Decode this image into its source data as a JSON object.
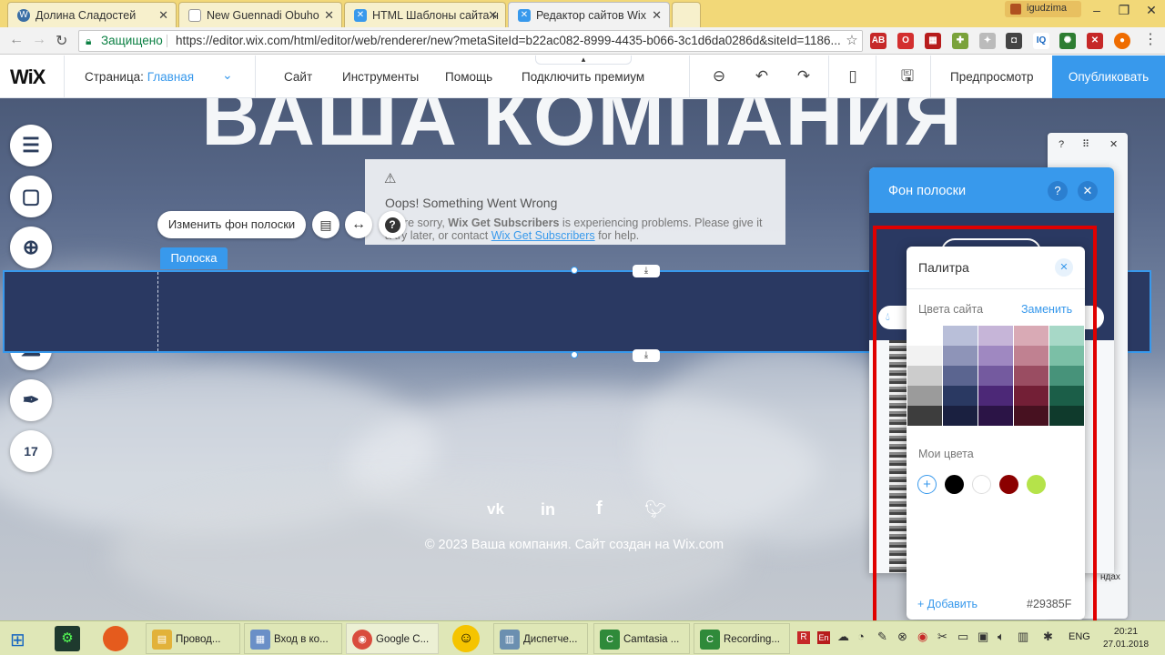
{
  "browser": {
    "tabs": [
      {
        "title": "Долина Сладостей",
        "icon": "wordpress-icon",
        "color": "#3a6ea5"
      },
      {
        "title": "New Guennadi Obuho",
        "icon": "doc-icon",
        "color": "#999999"
      },
      {
        "title": "HTML Шаблоны сайта н",
        "icon": "wix-icon",
        "color": "#3899ec"
      },
      {
        "title": "Редактор сайтов Wix",
        "icon": "wix-icon",
        "color": "#3899ec"
      }
    ],
    "user": "igudzima",
    "secure_label": "Защищено",
    "url": "https://editor.wix.com/html/editor/web/renderer/new?metaSiteId=b22ac082-8999-4435-b066-3c1d6da0286d&siteId=1186..."
  },
  "editor": {
    "logo": "WiX",
    "page_label": "Страница:",
    "page_name": "Главная",
    "menus": [
      "Сайт",
      "Инструменты",
      "Помощь",
      "Подключить премиум"
    ],
    "preview_label": "Предпросмотр",
    "publish_label": "Опубликовать"
  },
  "canvas": {
    "hero_title": "ВАША КОМПАНИЯ",
    "change_bg_label": "Изменить фон полоски",
    "strip_tag": "Полоска",
    "error_title": "Oops! Something Went Wrong",
    "error_text_1": "We're sorry, ",
    "error_app": "Wix Get Subscribers",
    "error_text_2": " is experiencing problems. Please give it",
    "error_text_3": "a try later, or contact ",
    "error_link": "Wix Get Subscribers",
    "error_text_4": " for help.",
    "footer_text": "© 2023 Ваша компания. Сайт создан на Wix.com",
    "social_icons": [
      "vk-icon",
      "linkedin-icon",
      "facebook-icon",
      "twitter-icon"
    ],
    "partial_label": "ндах"
  },
  "panel": {
    "title": "Фон полоски",
    "palette": {
      "title": "Палитра",
      "site_colors_label": "Цвета сайта",
      "replace_label": "Заменить",
      "site_color_columns": [
        [
          "#ffffff",
          "#f2f2f2",
          "#cccccc",
          "#9b9b9b",
          "#3d3d3d"
        ],
        [
          "#b9bfd9",
          "#8e94b8",
          "#5b6590",
          "#2a3962",
          "#1a2040"
        ],
        [
          "#c6b5d8",
          "#9f88c1",
          "#745a9f",
          "#4c2877",
          "#2b1446"
        ],
        [
          "#d9aab5",
          "#c08191",
          "#9a4d62",
          "#731f36",
          "#471120"
        ],
        [
          "#a7d8c7",
          "#7bbfa6",
          "#47937a",
          "#1b5e48",
          "#0f3a2c"
        ]
      ],
      "my_colors_label": "Мои цвета",
      "my_colors": [
        "#000000",
        "#ffffff",
        "#8b0000",
        "#b5e34a"
      ],
      "add_label": "+ Добавить",
      "current_hex": "#29385F"
    }
  },
  "taskbar": {
    "items": [
      {
        "label": "Провод...",
        "color": "#e2b23a"
      },
      {
        "label": "Вход в ко...",
        "color": "#6a8fc7"
      },
      {
        "label": "Google C...",
        "color": "#d94c3d"
      },
      {
        "label": "Диспетче...",
        "color": "#6b8fb0"
      },
      {
        "label": "Camtasia ...",
        "color": "#2f8a3a"
      },
      {
        "label": "Recording...",
        "color": "#2f8a3a"
      }
    ],
    "lang": "ENG",
    "time": "20:21",
    "date": "27.01.2018"
  }
}
